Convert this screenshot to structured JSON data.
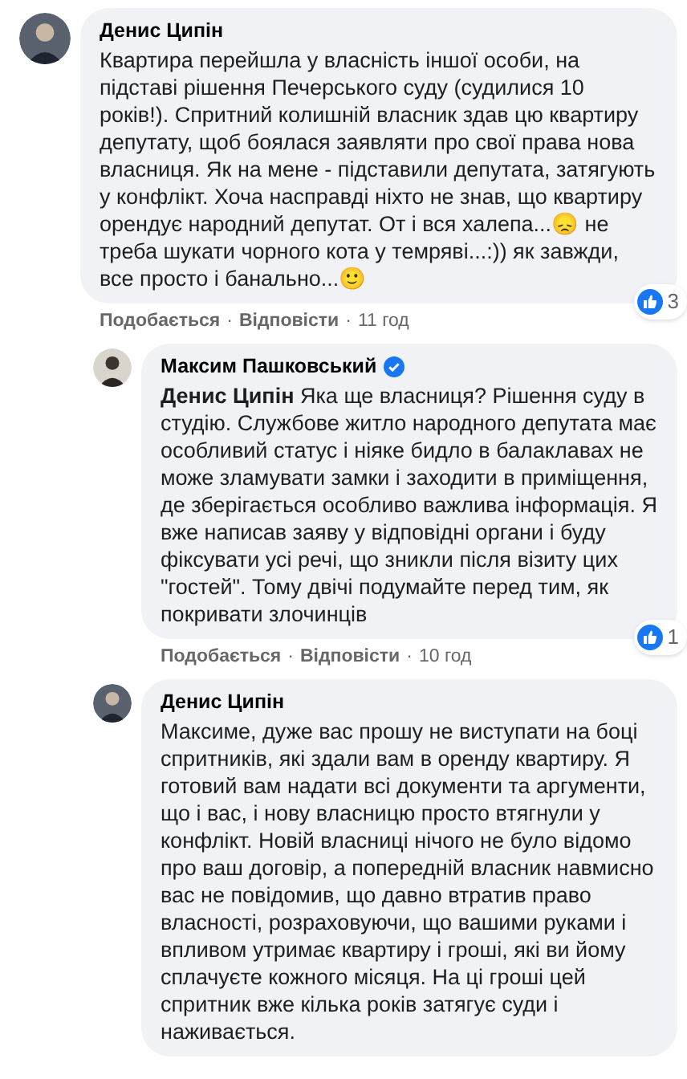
{
  "comments": [
    {
      "author": "Денис Ципін",
      "verified": false,
      "text": "Квартира перейшла у власність іншої особи, на підставі рішення Печерського суду (судилися 10 років!). Спритний колишній власник здав цю квартиру депутату, щоб боялася заявляти про свої права нова власниця. Як на мене - підставили депутата, затягують у конфлікт. Хоча насправді ніхто не знав, що квартиру орендує народний депутат. От і вся халепа...😞 не треба шукати чорного кота у темряві...:)) як завжди, все просто і банально...🙂",
      "reaction_count": "3",
      "actions": {
        "like": "Подобається",
        "separator": "·",
        "reply": "Відповісти",
        "separator_2": "·",
        "time": "11 год"
      },
      "children": [
        {
          "author": "Максим Пашковський",
          "verified": true,
          "text": "**Денис Ципін** Яка ще власниця? Рішення суду в студію. Службове житло народного депутата має особливий статус і ніяке бидло в балаклавах не може зламувати замки і заходити в приміщення, де зберігається особливо важлива інформація. Я вже написав заяву у відповідні органи і буду фіксувати усі речі, що зникли після візиту цих \"гостей\". Тому двічі подумайте перед тим, як покривати злочинців",
          "reaction_count": "1",
          "actions": {
            "like": "Подобається",
            "separator": "·",
            "reply": "Відповісти",
            "separator_2": "·",
            "time": "10 год"
          }
        },
        {
          "author": "Денис Ципін",
          "verified": false,
          "text": "Максиме, дуже вас прошу не виступати на боці спритників, які здали вам в оренду квартиру. Я готовий вам надати всі документи та аргументи, що і вас, і нову власницю просто втягнули у конфлікт. Новій власниці нічого не було відомо про ваш договір, а попередній власник навмисно вас не повідомив, що давно втратив право власності, розраховуючи, що вашими руками і впливом утримає квартиру і гроші, які ви йому сплачуєте кожного місяця. На ці гроші цей спритник вже кілька років затягує суди і наживається."
        }
      ]
    }
  ]
}
